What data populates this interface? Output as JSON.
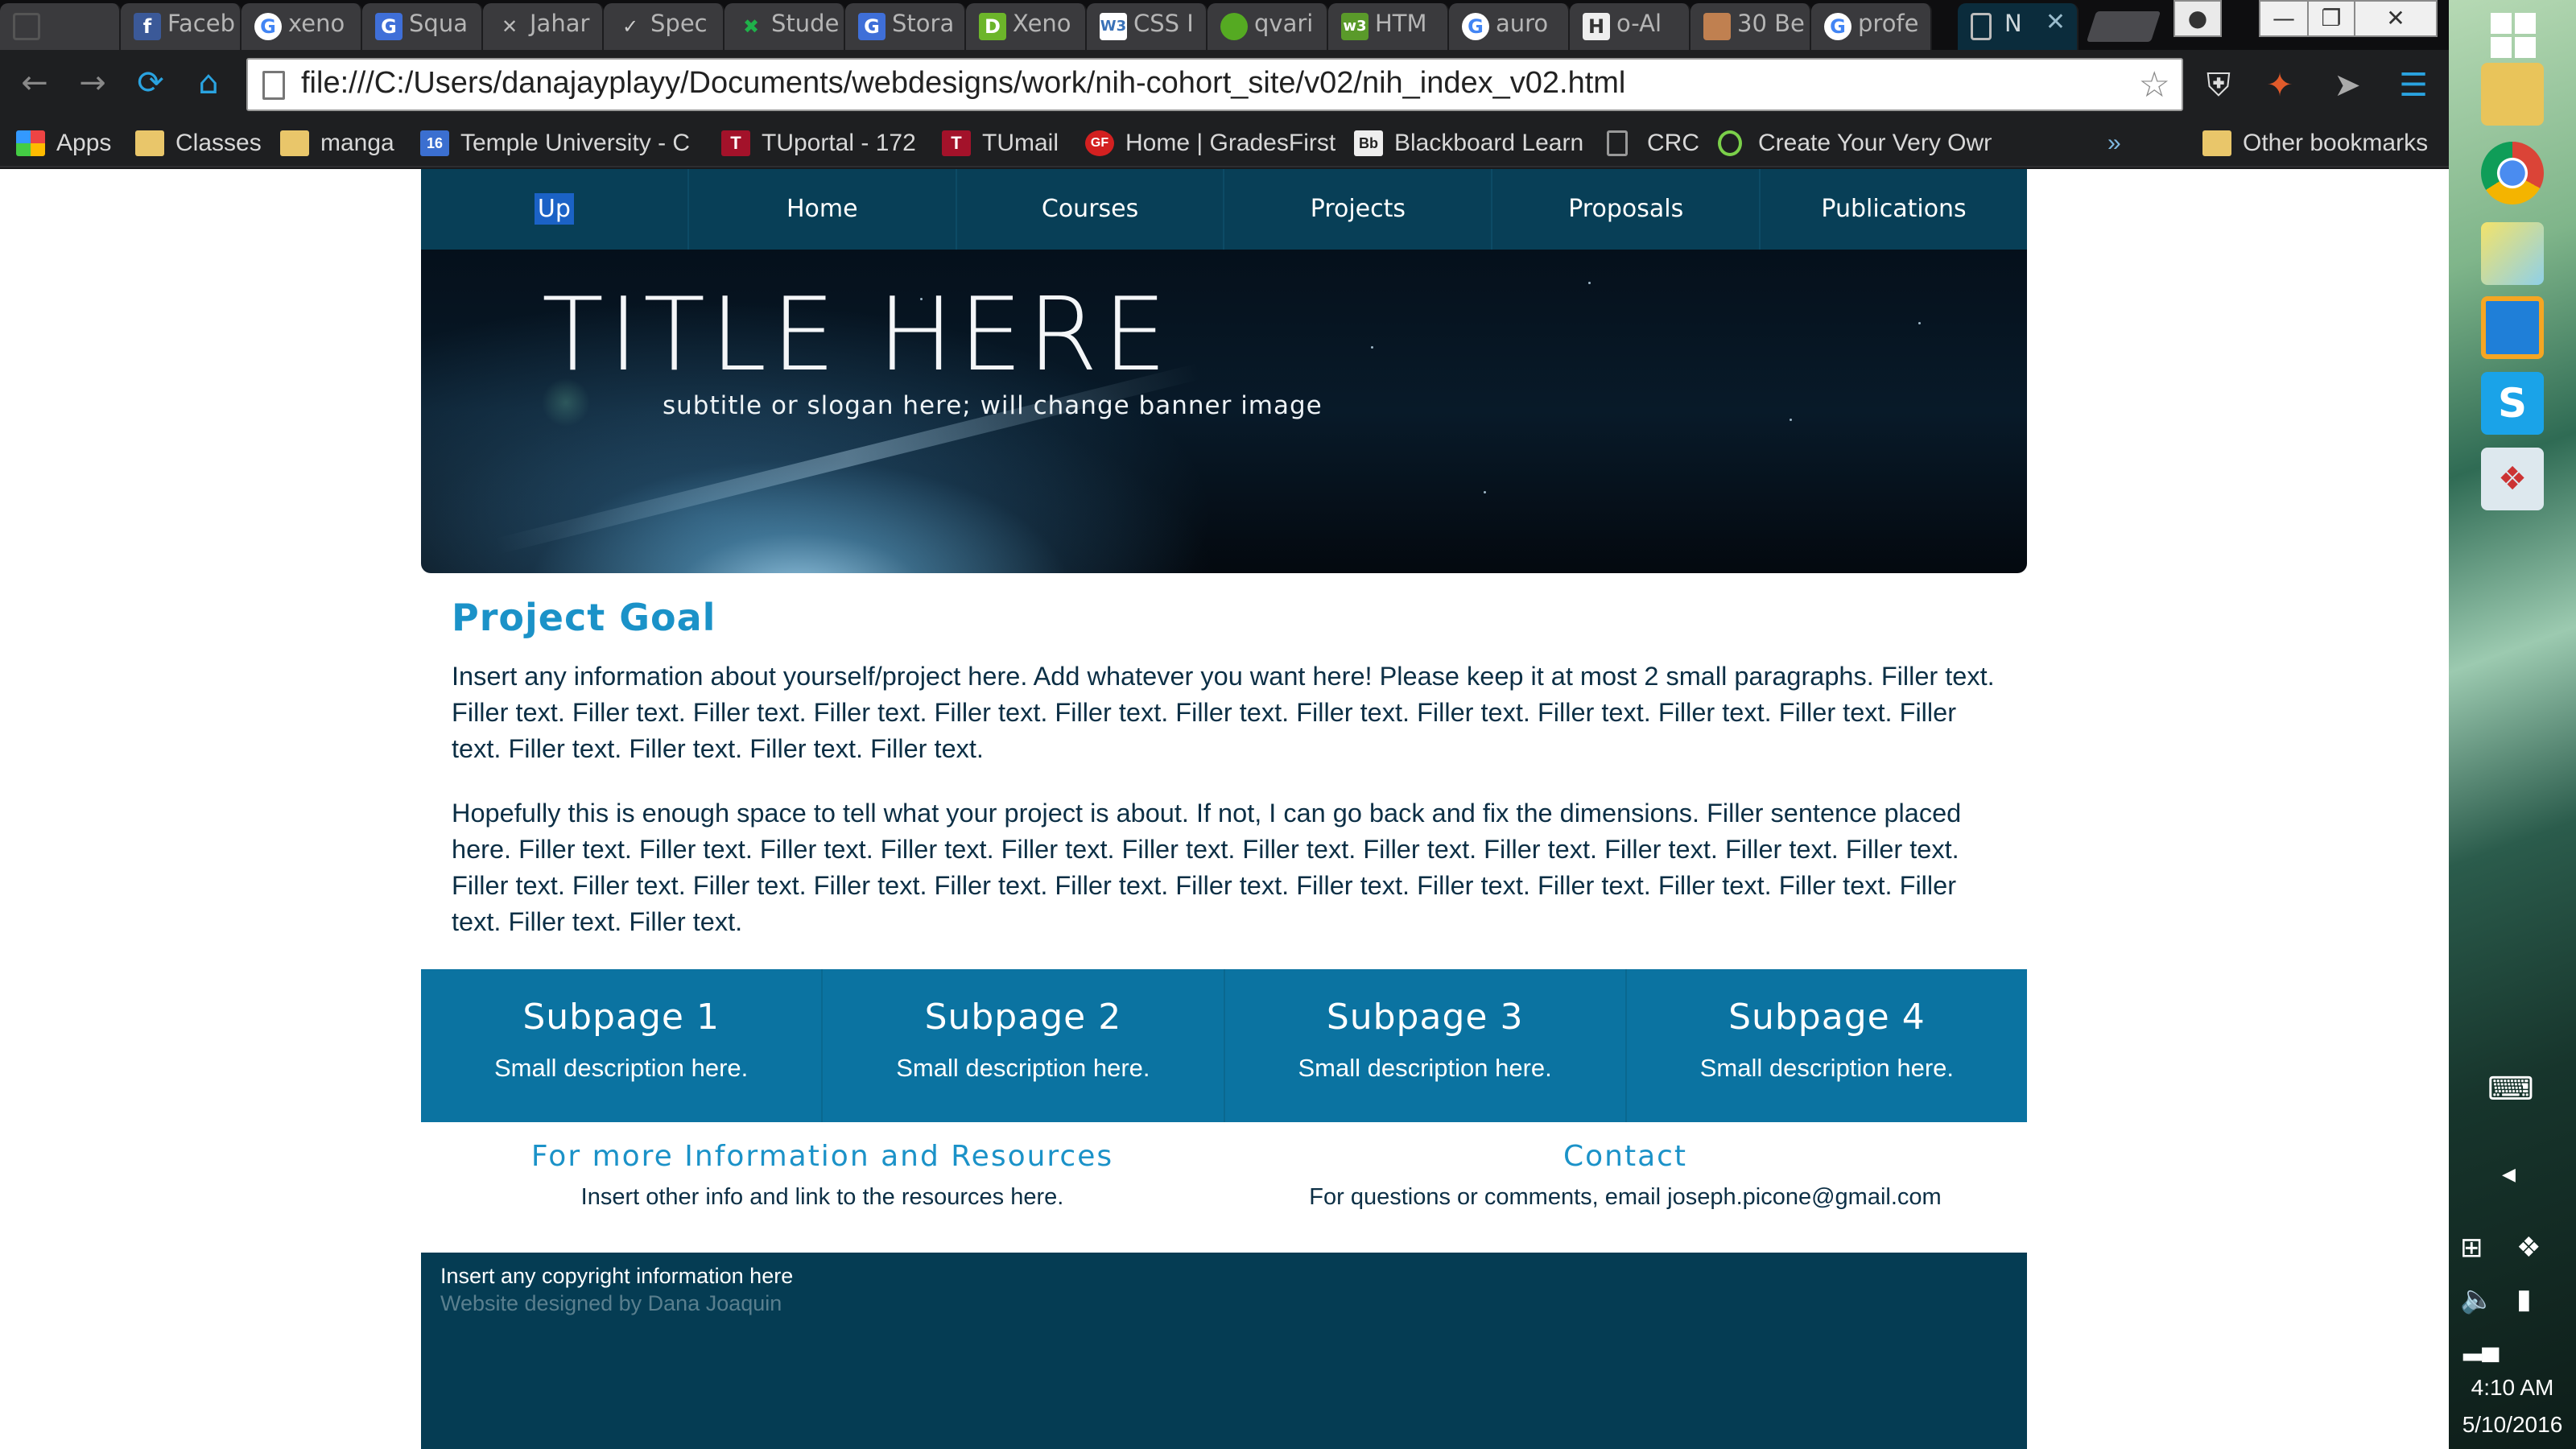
{
  "browser": {
    "tabs": [
      {
        "label": "",
        "icon": "blank-page-icon",
        "color": "#555555"
      },
      {
        "label": "Faceb",
        "icon": "facebook-icon",
        "color": "#3b5998"
      },
      {
        "label": "xeno",
        "icon": "google-icon",
        "color": "#ffffff"
      },
      {
        "label": "Squa",
        "icon": "gradient-g-icon",
        "color": "#3f6fd8"
      },
      {
        "label": "Jahar",
        "icon": "x-icon",
        "color": "#888888"
      },
      {
        "label": "Spec",
        "icon": "check-icon",
        "color": "#333333"
      },
      {
        "label": "Stude",
        "icon": "green-x-icon",
        "color": "#1fb14a"
      },
      {
        "label": "Stora",
        "icon": "gradient-g-icon",
        "color": "#3f6fd8"
      },
      {
        "label": "Xeno",
        "icon": "d-icon",
        "color": "#6cb52a"
      },
      {
        "label": "CSS I",
        "icon": "w3-icon",
        "color": "#3a72b8"
      },
      {
        "label": "qvari",
        "icon": "green-circle-icon",
        "color": "#55aa22"
      },
      {
        "label": "HTM",
        "icon": "w3-green-icon",
        "color": "#5a9a2a"
      },
      {
        "label": "auro",
        "icon": "google-icon",
        "color": "#ffffff"
      },
      {
        "label": "o-Al",
        "icon": "h-icon",
        "color": "#eeeeee"
      },
      {
        "label": "30 Be",
        "icon": "avatar-icon",
        "color": "#c08050"
      },
      {
        "label": "profe",
        "icon": "google-icon",
        "color": "#ffffff"
      },
      {
        "label": "N",
        "icon": "page-icon",
        "color": "#bbbbbb"
      }
    ],
    "url": "file:///C:/Users/danajayplayy/Documents/webdesigns/work/nih-cohort_site/v02/nih_index_v02.html",
    "bookmarks": [
      {
        "label": "Apps",
        "icon": "apps-grid-icon"
      },
      {
        "label": "Classes",
        "icon": "folder-icon"
      },
      {
        "label": "manga",
        "icon": "folder-icon"
      },
      {
        "label": "Temple University - C",
        "icon": "calendar-icon"
      },
      {
        "label": "TUportal - 172",
        "icon": "temple-t-icon"
      },
      {
        "label": "TUmail",
        "icon": "temple-t-icon"
      },
      {
        "label": "Home | GradesFirst",
        "icon": "gradesfirst-icon"
      },
      {
        "label": "Blackboard Learn",
        "icon": "blackboard-icon"
      },
      {
        "label": "CRC",
        "icon": "page-icon"
      },
      {
        "label": "Create Your Very Own",
        "icon": "refresh-circle-icon"
      }
    ],
    "overflow": "»",
    "other_bookmarks": "Other bookmarks"
  },
  "taskbar": {
    "time": "4:10 AM",
    "date": "5/10/2016"
  },
  "site": {
    "nav": [
      "Up",
      "Home",
      "Courses",
      "Projects",
      "Proposals",
      "Publications"
    ],
    "banner_title": "TITLE HERE",
    "banner_subtitle": "subtitle or slogan here; will change banner image",
    "goal_title": "Project Goal",
    "goal_p1": "Insert any information about yourself/project here. Add whatever you want here! Please keep it at most 2 small paragraphs. Filler text. Filler text. Filler text. Filler text. Filler text. Filler text. Filler text. Filler text. Filler text. Filler text. Filler text. Filler text. Filler text. Filler text. Filler text. Filler text. Filler text. Filler text.",
    "goal_p2": "Hopefully this is enough space to tell what your project is about. If not, I can go back and fix the dimensions. Filler sentence placed here. Filler text. Filler text. Filler text. Filler text. Filler text. Filler text. Filler text. Filler text. Filler text. Filler text. Filler text. Filler text. Filler text. Filler text. Filler text. Filler text. Filler text. Filler text. Filler text. Filler text. Filler text. Filler text. Filler text. Filler text. Filler text. Filler text. Filler text.",
    "subpages": [
      {
        "title": "Subpage 1",
        "desc": "Small description here."
      },
      {
        "title": "Subpage 2",
        "desc": "Small description here."
      },
      {
        "title": "Subpage 3",
        "desc": "Small description here."
      },
      {
        "title": "Subpage 4",
        "desc": "Small description here."
      }
    ],
    "info_title": "For more Information and Resources",
    "info_text": "Insert other info and link to the resources here.",
    "contact_title": "Contact",
    "contact_text": "For questions or comments, email joseph.picone@gmail.com",
    "footer_copyright": "Insert any copyright information here",
    "footer_designer": "Website designed by Dana Joaquin"
  }
}
